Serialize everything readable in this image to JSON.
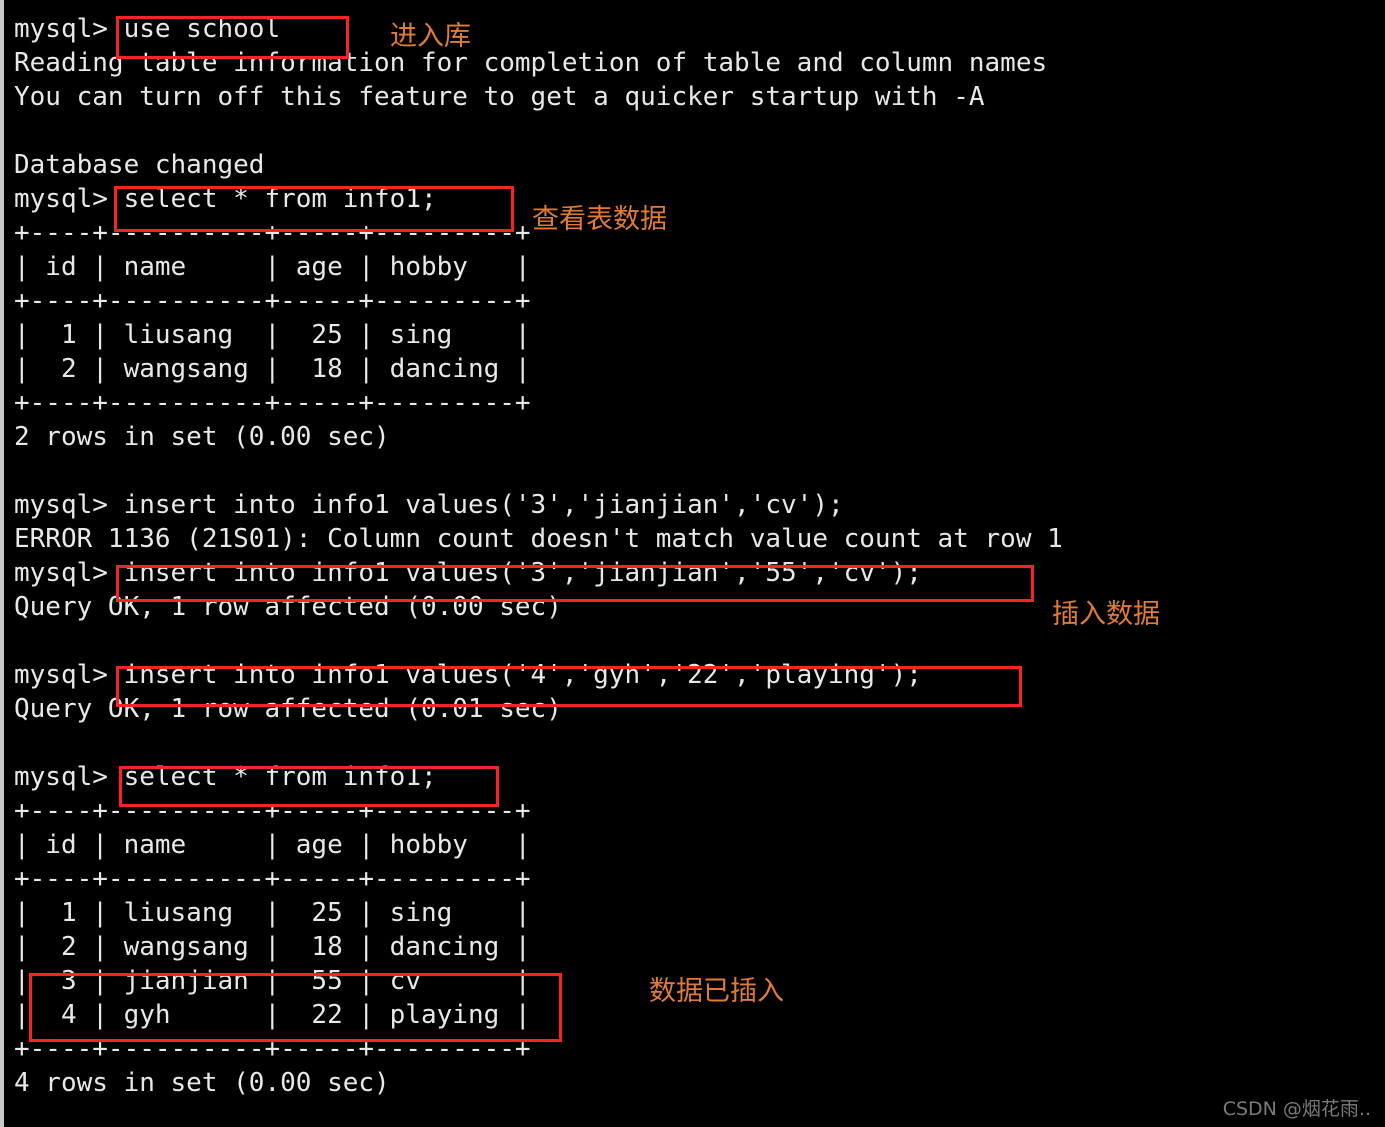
{
  "window": {
    "type": "terminal",
    "background_color": "#000000",
    "foreground_color": "#e8e8e8",
    "left_border_color": "#c9c9c9"
  },
  "terminal": {
    "prompt": "mysql>",
    "lines": [
      "mysql> use school",
      "Reading table information for completion of table and column names",
      "You can turn off this feature to get a quicker startup with -A",
      "",
      "Database changed",
      "mysql> select * from info1;",
      "+----+----------+-----+---------+",
      "| id | name     | age | hobby   |",
      "+----+----------+-----+---------+",
      "|  1 | liusang  |  25 | sing    |",
      "|  2 | wangsang |  18 | dancing |",
      "+----+----------+-----+---------+",
      "2 rows in set (0.00 sec)",
      "",
      "mysql> insert into info1 values('3','jianjian','cv');",
      "ERROR 1136 (21S01): Column count doesn't match value count at row 1",
      "mysql> insert into info1 values('3','jianjian','55','cv');",
      "Query OK, 1 row affected (0.00 sec)",
      "",
      "mysql> insert into info1 values('4','gyh','22','playing');",
      "Query OK, 1 row affected (0.01 sec)",
      "",
      "mysql> select * from info1;",
      "+----+----------+-----+---------+",
      "| id | name     | age | hobby   |",
      "+----+----------+-----+---------+",
      "|  1 | liusang  |  25 | sing    |",
      "|  2 | wangsang |  18 | dancing |",
      "|  3 | jianjian |  55 | cv      |",
      "|  4 | gyh      |  22 | playing |",
      "+----+----------+-----+---------+",
      "4 rows in set (0.00 sec)"
    ]
  },
  "commands": {
    "use_database": "use school",
    "select_first": "select * from info1;",
    "insert_bad": "insert into info1 values('3','jianjian','cv');",
    "insert_jianjian": "insert into info1 values('3','jianjian','55','cv');",
    "insert_gyh": "insert into info1 values('4','gyh','22','playing');",
    "select_second": "select * from info1;"
  },
  "results": {
    "reading_table_info": "Reading table information for completion of table and column names",
    "turn_off_hint": "You can turn off this feature to get a quicker startup with -A",
    "database_changed": "Database changed",
    "error_1136": "ERROR 1136 (21S01): Column count doesn't match value count at row 1",
    "query_ok_000": "Query OK, 1 row affected (0.00 sec)",
    "query_ok_001": "Query OK, 1 row affected (0.01 sec)",
    "rows_2": "2 rows in set (0.00 sec)",
    "rows_4": "4 rows in set (0.00 sec)"
  },
  "table_first": {
    "columns": [
      "id",
      "name",
      "age",
      "hobby"
    ],
    "rows": [
      [
        "1",
        "liusang",
        "25",
        "sing"
      ],
      [
        "2",
        "wangsang",
        "18",
        "dancing"
      ]
    ],
    "row_count_text": "2 rows in set (0.00 sec)"
  },
  "table_second": {
    "columns": [
      "id",
      "name",
      "age",
      "hobby"
    ],
    "rows": [
      [
        "1",
        "liusang",
        "25",
        "sing"
      ],
      [
        "2",
        "wangsang",
        "18",
        "dancing"
      ],
      [
        "3",
        "jianjian",
        "55",
        "cv"
      ],
      [
        "4",
        "gyh",
        "22",
        "playing"
      ]
    ],
    "row_count_text": "4 rows in set (0.00 sec)"
  },
  "annotations": {
    "color": "#e07b33",
    "box_color": "#f62525",
    "items": [
      {
        "label": "进入库",
        "meaning": "enter-database"
      },
      {
        "label": "查看表数据",
        "meaning": "view-table-data"
      },
      {
        "label": "插入数据",
        "meaning": "insert-data"
      },
      {
        "label": "数据已插入",
        "meaning": "data-inserted"
      }
    ]
  },
  "watermark": {
    "text": "CSDN @烟花雨.."
  }
}
